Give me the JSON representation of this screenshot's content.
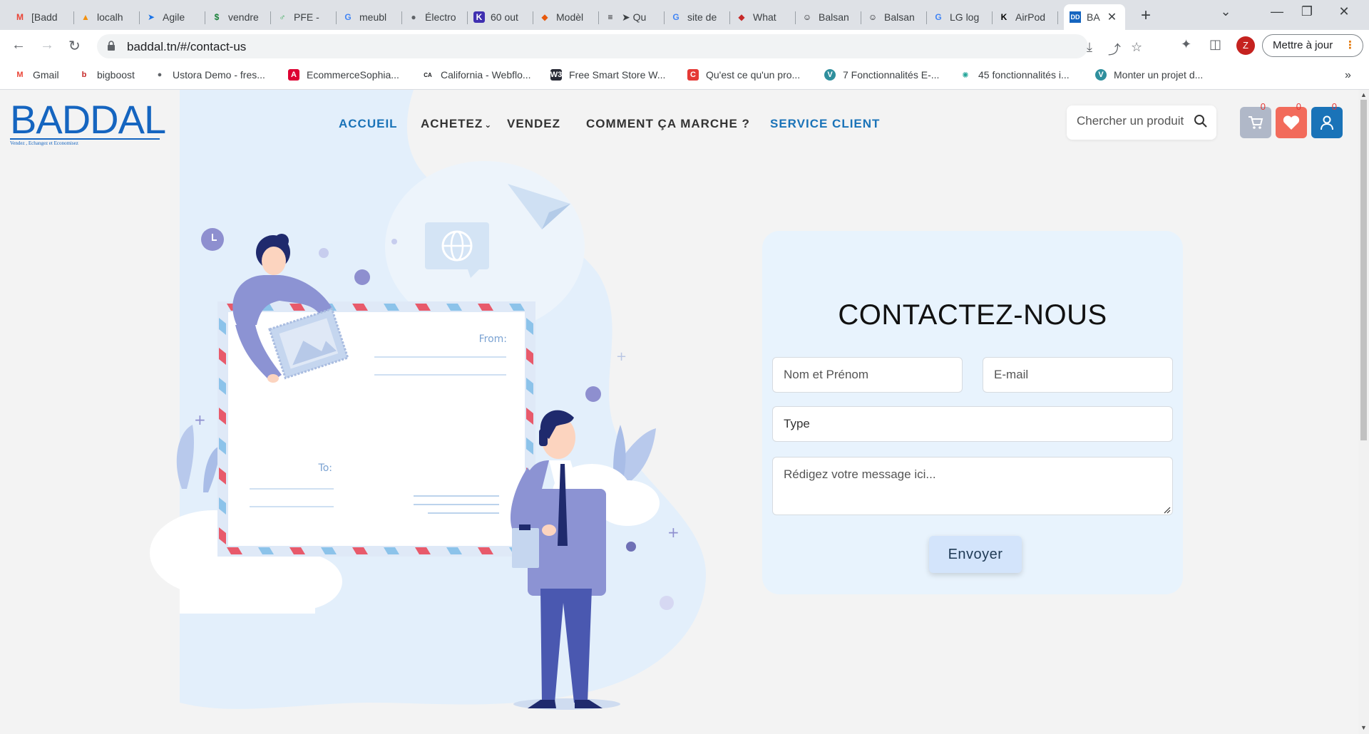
{
  "browser": {
    "tabs": [
      {
        "title": "[Badd",
        "icon": "gmail-icon",
        "color": "#ea4335"
      },
      {
        "title": "localh",
        "icon": "phpmyadmin-icon",
        "color": "#f29111"
      },
      {
        "title": "Agile",
        "icon": "send-icon",
        "color": "#1a73e8"
      },
      {
        "title": "vendre",
        "icon": "dollar-icon",
        "color": "#188038"
      },
      {
        "title": "PFE -",
        "icon": "pfe-icon",
        "color": "#34a853"
      },
      {
        "title": "meubl",
        "icon": "google-icon",
        "color": "#4285f4"
      },
      {
        "title": "Électro",
        "icon": "globe-icon",
        "color": "#5f6368"
      },
      {
        "title": "60 out",
        "icon": "k-icon",
        "color": "#3f2fb0"
      },
      {
        "title": "Modèl",
        "icon": "diamond-icon",
        "color": "#e8590c"
      },
      {
        "title": "➤ Qu",
        "icon": "menu-icon",
        "color": "#202124"
      },
      {
        "title": "site de",
        "icon": "google-icon",
        "color": "#4285f4"
      },
      {
        "title": "What",
        "icon": "ruby-icon",
        "color": "#c62828"
      },
      {
        "title": "Balsan",
        "icon": "smiley-icon",
        "color": "#202124"
      },
      {
        "title": "Balsan",
        "icon": "smiley-icon",
        "color": "#202124"
      },
      {
        "title": "LG log",
        "icon": "google-icon",
        "color": "#4285f4"
      },
      {
        "title": "AirPod",
        "icon": "kk-icon",
        "color": "#000000"
      },
      {
        "title": "BA",
        "icon": "dd-icon",
        "color": "#1565c0"
      }
    ],
    "url": "baddal.tn/#/contact-us",
    "update_label": "Mettre à jour",
    "profile_initial": "Z",
    "bookmarks": [
      {
        "label": "Gmail",
        "icon": "gmail-icon"
      },
      {
        "label": "bigboost",
        "icon": "bigboost-icon"
      },
      {
        "label": "Ustora Demo - fres...",
        "icon": "globe-icon"
      },
      {
        "label": "EcommerceSophia...",
        "icon": "angular-icon"
      },
      {
        "label": "California - Webflo...",
        "icon": "ca-icon"
      },
      {
        "label": "Free Smart Store W...",
        "icon": "w3-icon"
      },
      {
        "label": "Qu'est ce qu'un pro...",
        "icon": "c-icon"
      },
      {
        "label": "7 Fonctionnalités E-...",
        "icon": "v-icon"
      },
      {
        "label": "45 fonctionnalités i...",
        "icon": "dots-icon"
      },
      {
        "label": "Monter un projet d...",
        "icon": "v-icon"
      }
    ]
  },
  "site": {
    "logo": "BADDAL",
    "tagline": "Vendez , Echangez et Economisez",
    "nav": {
      "home": "ACCUEIL",
      "buy": "ACHETEZ",
      "sell": "VENDEZ",
      "how": "COMMENT ÇA MARCHE ?",
      "support": "SERVICE CLIENT"
    },
    "search_placeholder": "Chercher un produit",
    "cart_count": "0",
    "wishlist_count": "0",
    "account_count": "0",
    "accent": "#1a73b8"
  },
  "illustration": {
    "from_label": "From:",
    "to_label": "To:"
  },
  "contact": {
    "title": "CONTACTEZ-NOUS",
    "name_placeholder": "Nom et Prénom",
    "email_placeholder": "E-mail",
    "type_value": "Type",
    "message_placeholder": "Rédigez votre message ici...",
    "submit": "Envoyer"
  }
}
